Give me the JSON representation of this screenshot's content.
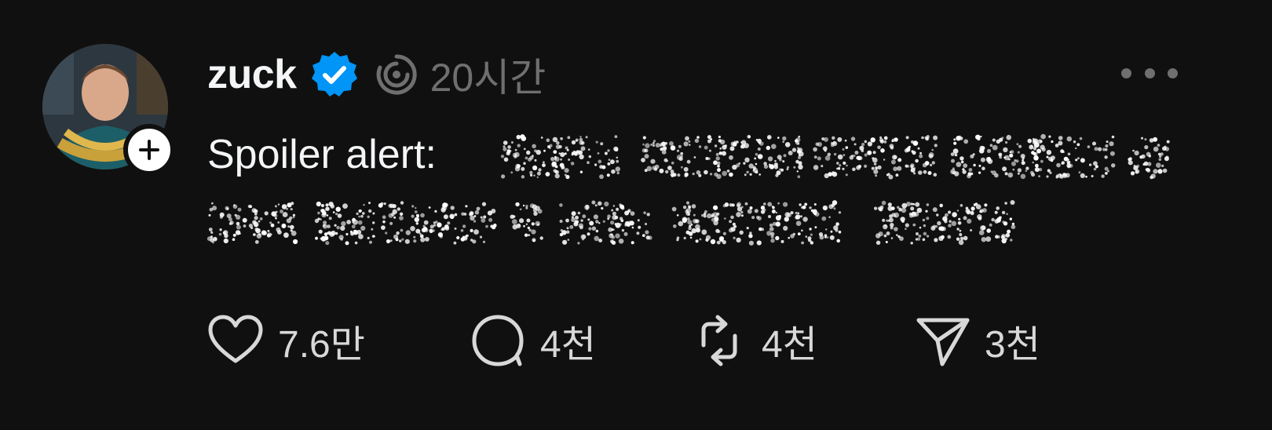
{
  "post": {
    "author": {
      "username": "zuck",
      "verified": true,
      "avatar_icon": "profile-photo",
      "follow_icon": "plus-icon"
    },
    "time_label": "20시간",
    "text_prefix": "Spoiler alert:",
    "spoiler_hidden": true,
    "more_icon": "more-horizontal-icon",
    "actions": [
      {
        "name": "like",
        "icon": "heart-icon",
        "count": "7.6만"
      },
      {
        "name": "reply",
        "icon": "comment-icon",
        "count": "4천"
      },
      {
        "name": "repost",
        "icon": "repost-icon",
        "count": "4천"
      },
      {
        "name": "share",
        "icon": "send-icon",
        "count": "3천"
      }
    ]
  },
  "colors": {
    "background": "#101010",
    "text_primary": "#f3f5f7",
    "text_secondary": "#6f6f6f",
    "verified": "#0095f6"
  }
}
